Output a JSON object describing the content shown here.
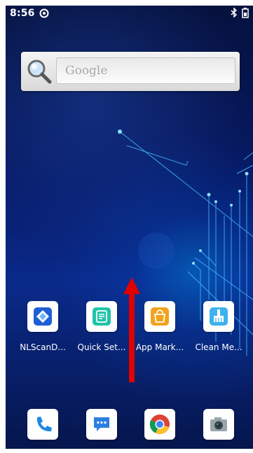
{
  "status_bar": {
    "time": "8:56",
    "left_icons": [
      "alert-circle-icon"
    ],
    "right_icons": [
      "bluetooth-icon",
      "battery-icon"
    ]
  },
  "search_widget": {
    "placeholder": "Google",
    "icon": "search-icon"
  },
  "apps": [
    {
      "label": "NLScanD...",
      "icon": "nlscan-icon",
      "accent": "#1f5fd6"
    },
    {
      "label": "Quick Set...",
      "icon": "quick-settings-icon",
      "accent": "#21c4a8"
    },
    {
      "label": "App Mark...",
      "icon": "app-market-icon",
      "accent": "#f3a21c"
    },
    {
      "label": "Clean Me...",
      "icon": "clean-memory-icon",
      "accent": "#3db2ee"
    }
  ],
  "dock": [
    {
      "icon": "phone-icon",
      "accent": "#1e88e5"
    },
    {
      "icon": "messages-icon",
      "accent": "#2b7fe0"
    },
    {
      "icon": "chrome-icon",
      "accent": "#db4437"
    },
    {
      "icon": "camera-icon",
      "accent": "#546e7a"
    }
  ],
  "overlay": {
    "gesture": "swipe-up-arrow",
    "color": "#e00000"
  },
  "colors": {
    "wallpaper_dark": "#06113d",
    "wallpaper_accent": "#00aaff"
  }
}
